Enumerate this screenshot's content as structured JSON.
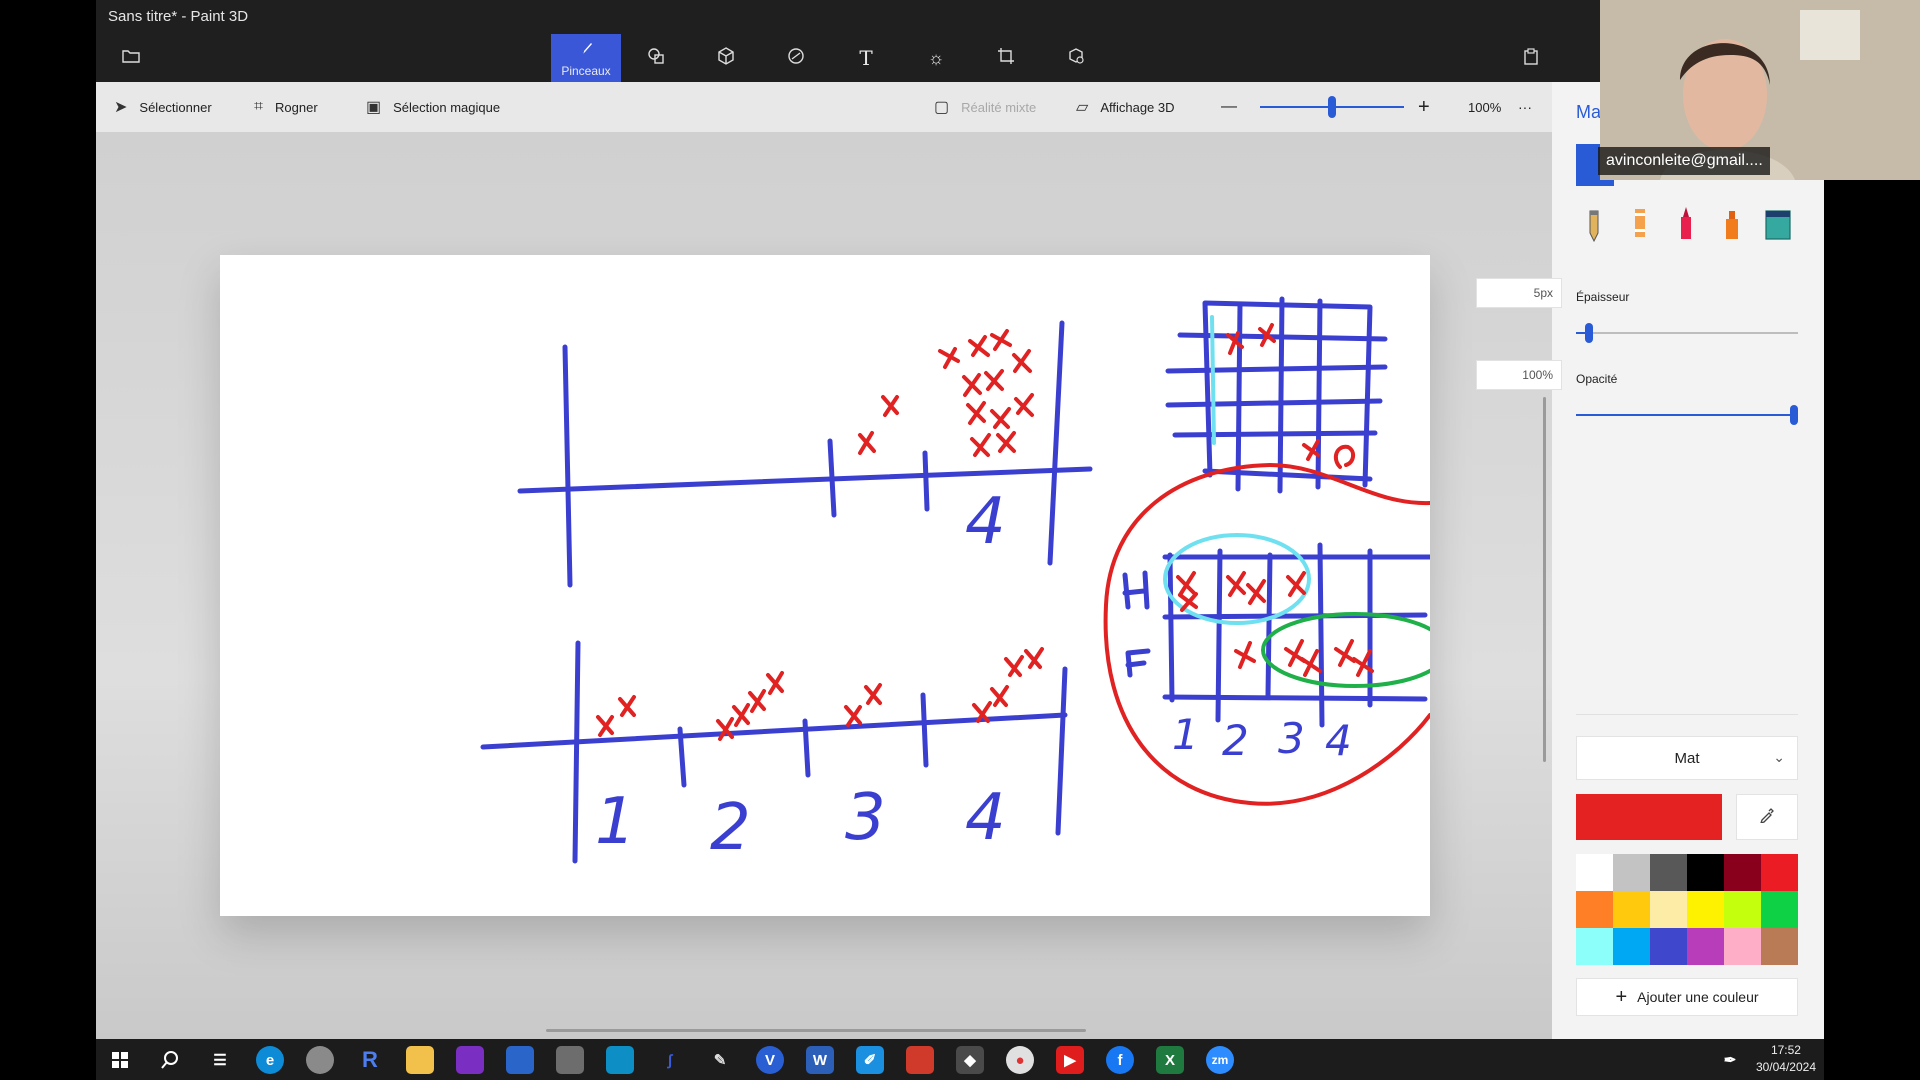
{
  "window": {
    "title": "Sans titre* - Paint 3D"
  },
  "ribbon": {
    "active_tool": "Pinceaux",
    "tools": [
      "folder-icon",
      "brush-icon",
      "shapes-2d-icon",
      "shapes-3d-icon",
      "stickers-icon",
      "text-icon",
      "effects-icon",
      "canvas-icon",
      "library-3d-icon"
    ]
  },
  "toolbar": {
    "select": "Sélectionner",
    "crop": "Rogner",
    "magic_select": "Sélection magique",
    "mixed_reality": "Réalité mixte",
    "view_3d": "Affichage 3D",
    "zoom_minus": "—",
    "zoom_plus": "+",
    "zoom": "100%",
    "more": "···"
  },
  "panel": {
    "title": "Ma",
    "thickness_label": "Épaisseur",
    "thickness_value": "5px",
    "thickness_level": 0.04,
    "opacity_label": "Opacité",
    "opacity_value": "100%",
    "opacity_level": 1.0,
    "finish": "Mat",
    "current_color": "#e52222",
    "add_color": "Ajouter une couleur",
    "palette": [
      "#ffffff",
      "#c3c3c3",
      "#585858",
      "#000000",
      "#88001b",
      "#ec1c24",
      "#ff7f27",
      "#ffc90e",
      "#fdeca6",
      "#fff200",
      "#c4ff0e",
      "#0ed145",
      "#8cfffb",
      "#00a8f3",
      "#3f48cc",
      "#b83dba",
      "#ffaec8",
      "#b97a56"
    ]
  },
  "webcam": {
    "email": "avinconleite@gmail...."
  },
  "canvas": {
    "labels_top": [
      "4"
    ],
    "labels_bottom": [
      "1",
      "2",
      "3",
      "4"
    ],
    "labels_grid": [
      "H",
      "F",
      "1",
      "2",
      "3",
      "4"
    ]
  },
  "taskbar": {
    "time": "17:52",
    "date": "30/04/2024"
  }
}
